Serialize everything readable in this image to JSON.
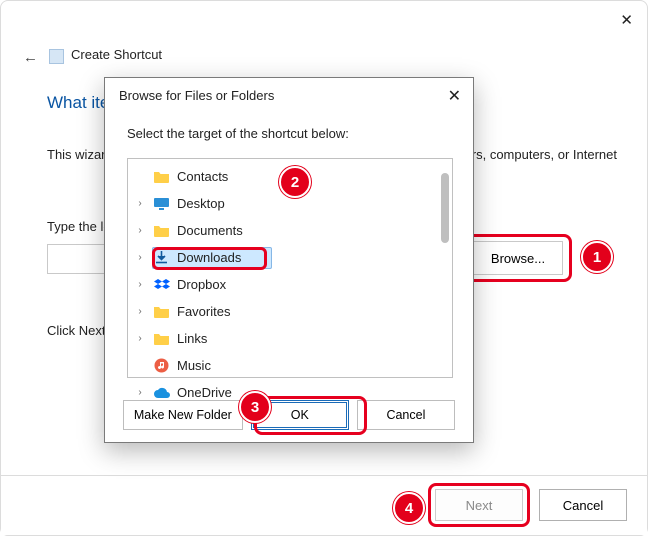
{
  "outer": {
    "title": "Create Shortcut",
    "question_prefix": "What ite",
    "description_prefix": "This wizard",
    "description_suffix": ", files, folders, computers, or Internet",
    "type_label_prefix": "Type the lo",
    "click_next_prefix": "Click Next",
    "browse_label": "Browse...",
    "next_label": "Next",
    "cancel_label": "Cancel"
  },
  "browse": {
    "title": "Browse for Files or Folders",
    "instruction": "Select the target of the shortcut below:",
    "make_new_folder": "Make New Folder",
    "ok": "OK",
    "cancel": "Cancel",
    "tree": [
      {
        "label": "Contacts",
        "expandable": false,
        "icon": "folder",
        "selected": false
      },
      {
        "label": "Desktop",
        "expandable": true,
        "icon": "desktop",
        "selected": false
      },
      {
        "label": "Documents",
        "expandable": true,
        "icon": "folder",
        "selected": false
      },
      {
        "label": "Downloads",
        "expandable": true,
        "icon": "download",
        "selected": true
      },
      {
        "label": "Dropbox",
        "expandable": true,
        "icon": "dropbox",
        "selected": false
      },
      {
        "label": "Favorites",
        "expandable": true,
        "icon": "folder",
        "selected": false
      },
      {
        "label": "Links",
        "expandable": true,
        "icon": "folder",
        "selected": false
      },
      {
        "label": "Music",
        "expandable": false,
        "icon": "music",
        "selected": false
      },
      {
        "label": "OneDrive",
        "expandable": true,
        "icon": "onedrive",
        "selected": false
      }
    ]
  },
  "badges": {
    "b1": "1",
    "b2": "2",
    "b3": "3",
    "b4": "4"
  }
}
